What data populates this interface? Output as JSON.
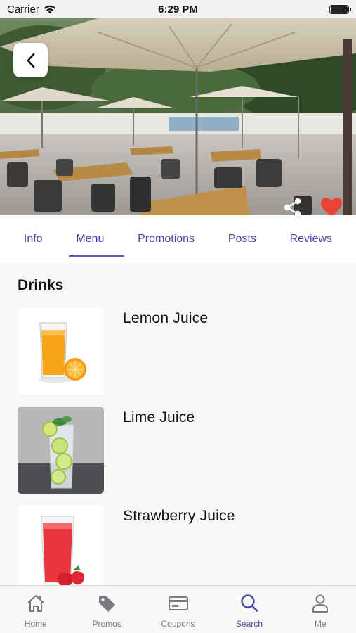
{
  "status_bar": {
    "carrier": "Carrier",
    "time": "6:29 PM",
    "icons": [
      "wifi-icon",
      "battery-icon"
    ]
  },
  "hero": {
    "icons": [
      "back-icon",
      "share-icon",
      "heart-icon"
    ],
    "favorite_color": "#e8443a",
    "favorited": true
  },
  "tabs": {
    "items": [
      {
        "label": "Info"
      },
      {
        "label": "Menu"
      },
      {
        "label": "Promotions"
      },
      {
        "label": "Posts"
      },
      {
        "label": "Reviews"
      }
    ],
    "active": "Menu",
    "accent_color": "#4a47a3"
  },
  "menu": {
    "section_title": "Drinks",
    "items": [
      {
        "name": "Lemon Juice"
      },
      {
        "name": "Lime Juice"
      },
      {
        "name": "Strawberry Juice"
      }
    ]
  },
  "tab_bar": {
    "items": [
      {
        "label": "Home",
        "icon": "home-icon"
      },
      {
        "label": "Promos",
        "icon": "tag-icon"
      },
      {
        "label": "Coupons",
        "icon": "coupon-card-icon"
      },
      {
        "label": "Search",
        "icon": "search-icon"
      },
      {
        "label": "Me",
        "icon": "person-icon"
      }
    ],
    "active": "Search"
  }
}
